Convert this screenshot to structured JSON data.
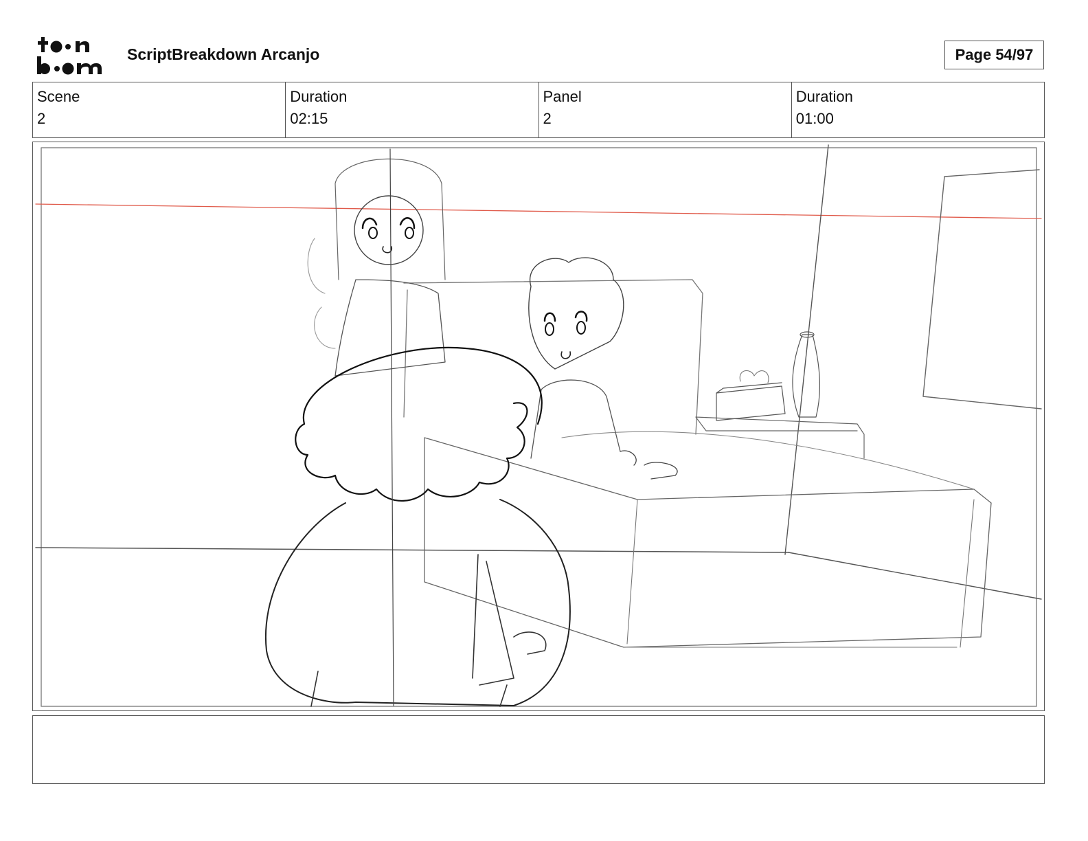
{
  "header": {
    "logo_text": "toonboom",
    "title": "ScriptBreakdown Arcanjo",
    "page_label": "Page 54/97"
  },
  "info": [
    {
      "label": "Scene",
      "value": "2"
    },
    {
      "label": "Duration",
      "value": "02:15"
    },
    {
      "label": "Panel",
      "value": "2"
    },
    {
      "label": "Duration",
      "value": "01:00"
    }
  ],
  "notes": {
    "text": ""
  },
  "icons": {
    "logo": "toon-boom-logo"
  }
}
